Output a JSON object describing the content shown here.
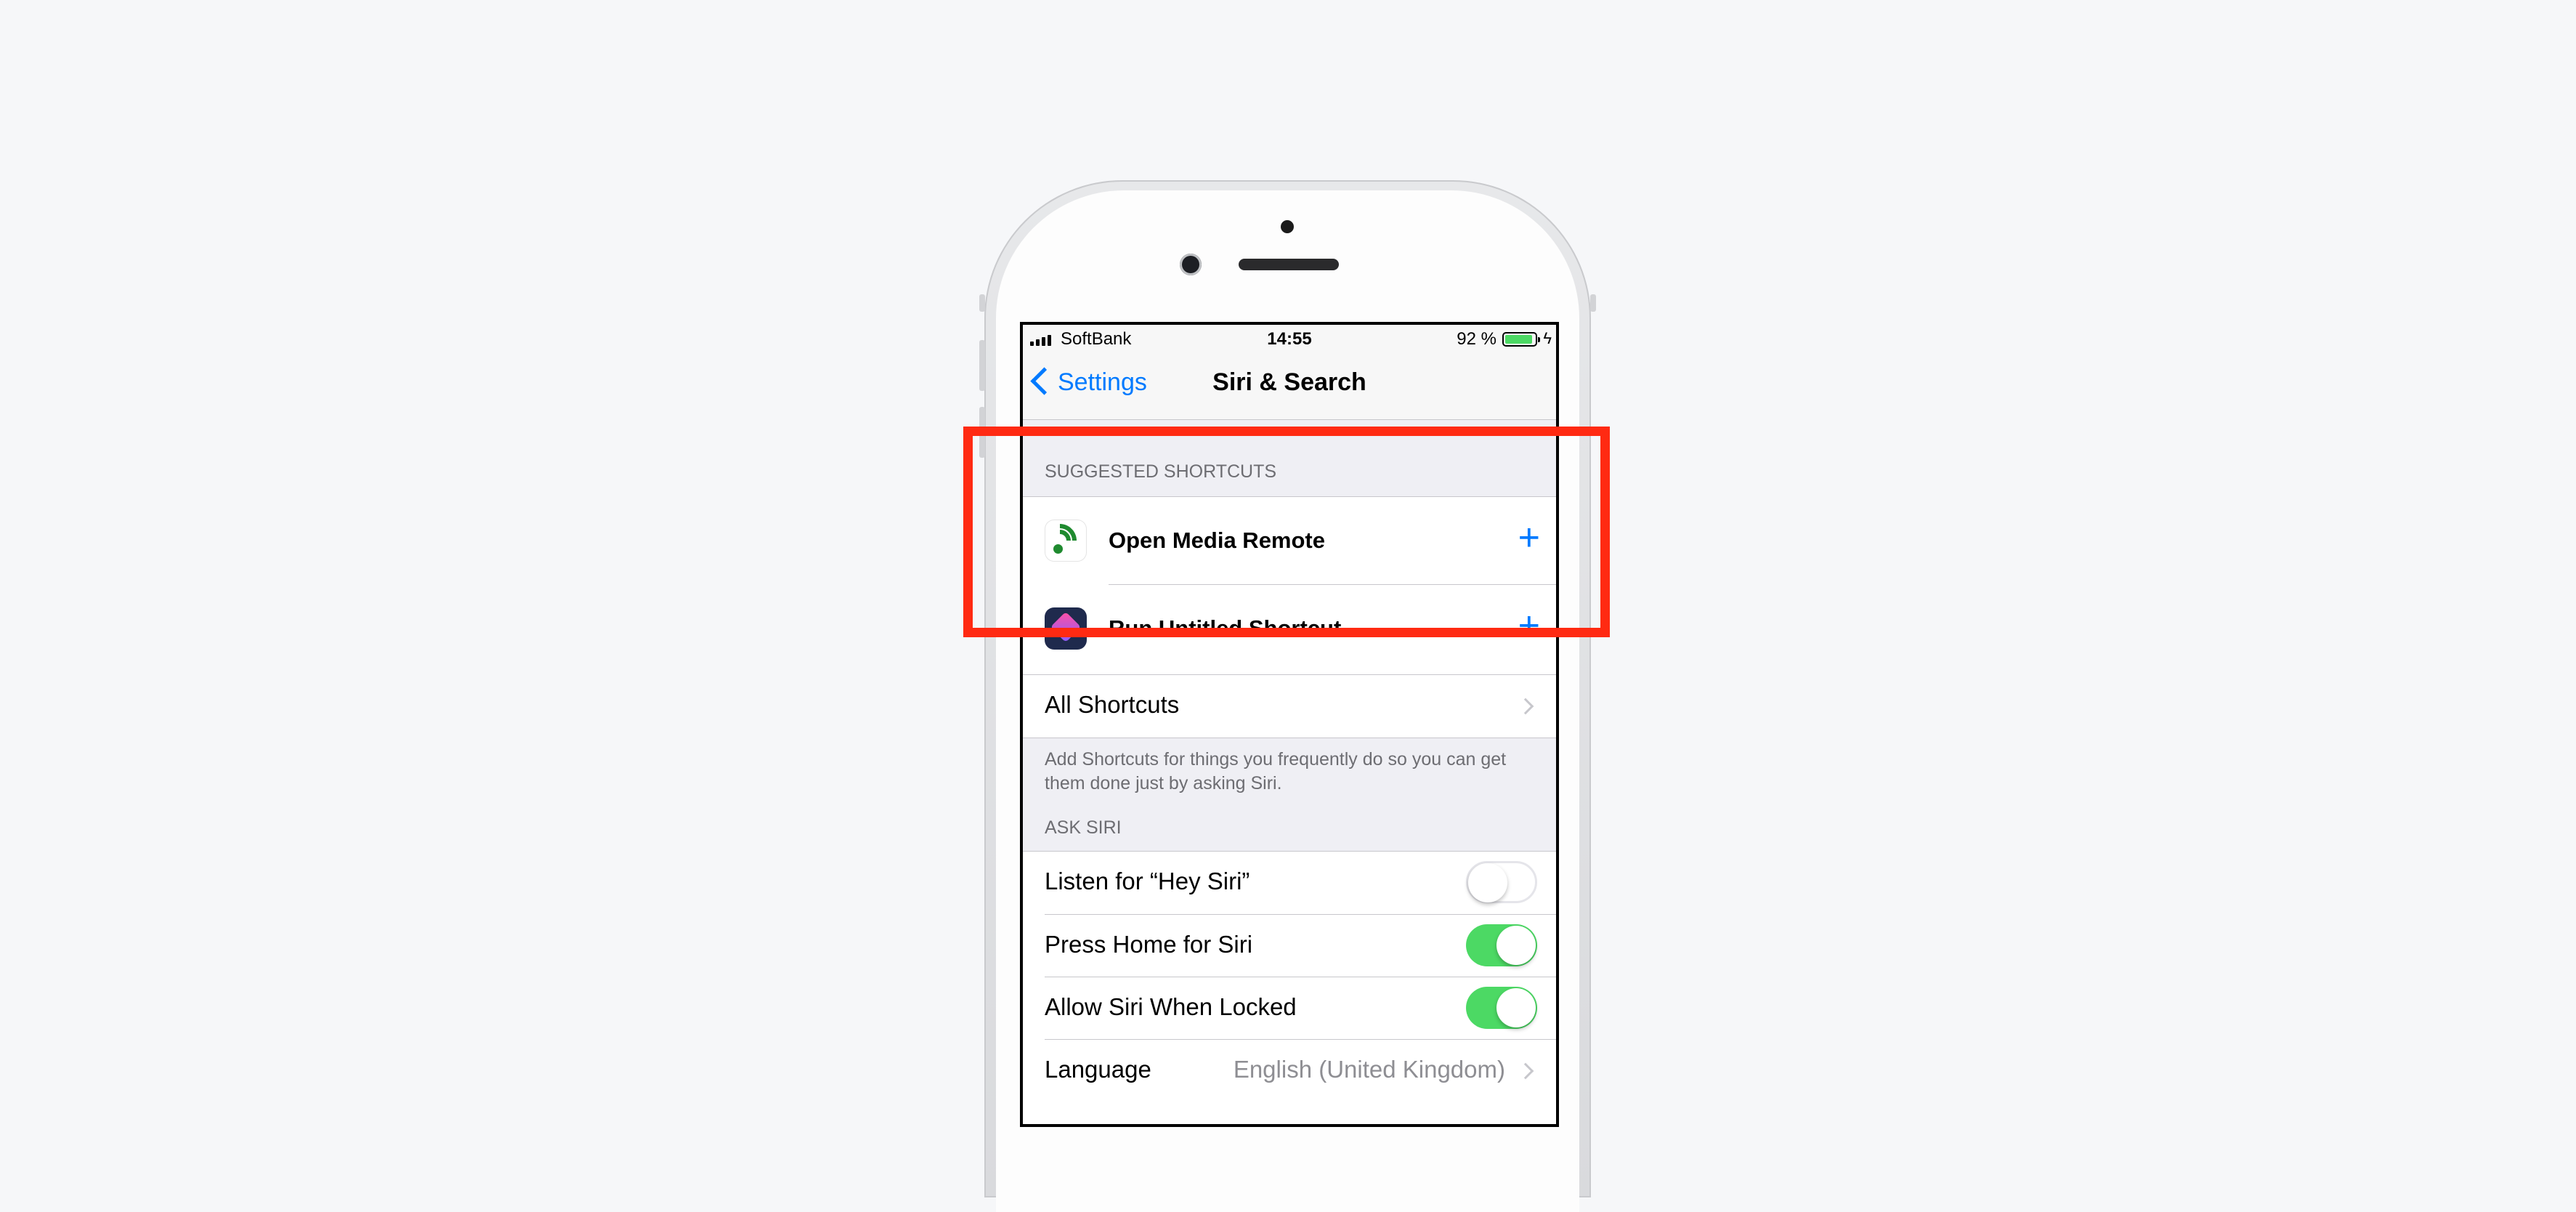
{
  "status_bar": {
    "carrier": "SoftBank",
    "time": "14:55",
    "battery": "92 %",
    "battery_level": 0.92
  },
  "nav": {
    "back_label": "Settings",
    "title": "Siri & Search"
  },
  "suggested": {
    "header": "SUGGESTED SHORTCUTS",
    "items": [
      {
        "label": "Open Media Remote",
        "icon": "media-remote-icon"
      },
      {
        "label": "Run Untitled Shortcut",
        "icon": "shortcuts-icon"
      }
    ],
    "all_shortcuts": "All Shortcuts",
    "footer": "Add Shortcuts for things you frequently do so you can get them done just by asking Siri."
  },
  "ask_siri": {
    "header": "ASK SIRI",
    "rows": [
      {
        "label": "Listen for “Hey Siri”",
        "toggle": false
      },
      {
        "label": "Press Home for Siri",
        "toggle": true
      },
      {
        "label": "Allow Siri When Locked",
        "toggle": true
      }
    ],
    "language_label": "Language",
    "language_value": "English (United Kingdom)"
  },
  "colors": {
    "accent": "#007aff",
    "toggle_on": "#4cd964",
    "highlight": "#ff2a12"
  }
}
